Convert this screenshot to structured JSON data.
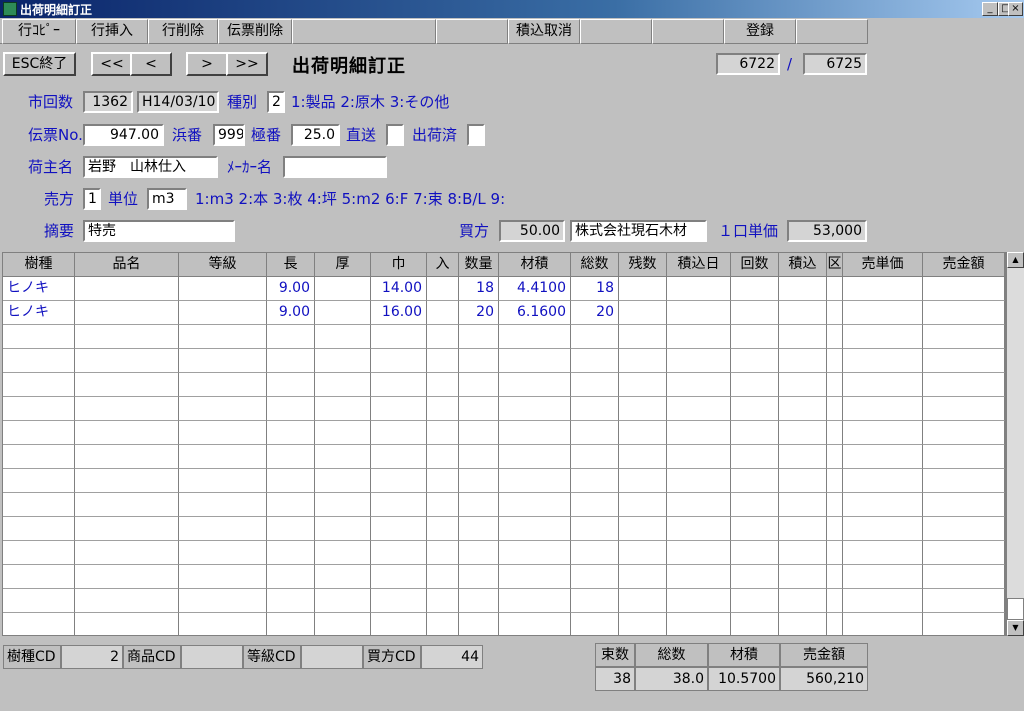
{
  "window": {
    "title": "出荷明細訂正",
    "btn_min": "_",
    "btn_max": "□",
    "btn_close": "×"
  },
  "menu": [
    "行ｺﾋﾟｰ",
    "行挿入",
    "行削除",
    "伝票削除",
    "",
    "",
    "積込取消",
    "",
    "",
    "登録",
    ""
  ],
  "toolbar": {
    "esc": "ESC終了",
    "first": "<<",
    "prev": "<",
    "next": ">",
    "last": ">>",
    "heading": "出荷明細訂正",
    "current": "6722",
    "sep": "/",
    "total": "6725"
  },
  "form": {
    "kaisu_label": "市回数",
    "kaisu": "1362",
    "date": "H14/03/10",
    "shubetsu_label": "種別",
    "shubetsu": "2",
    "shubetsu_hint": "1:製品 2:原木 3:その他",
    "denpyo_label": "伝票No.",
    "denpyo": "947.00",
    "hama_label": "浜番",
    "hama": "999",
    "goku_label": "極番",
    "goku": "25.0",
    "chokuso_label": "直送",
    "chokuso": "",
    "shukka_label": "出荷済",
    "shukka": "",
    "ninushi_label": "荷主名",
    "ninushi": "岩野　山林仕入",
    "maker_label": "ﾒｰｶｰ名",
    "maker": "",
    "urikata_label": "売方",
    "urikata": "1",
    "tani_label": "単位",
    "tani": "m3",
    "tani_hint": "1:m3 2:本 3:枚 4:坪 5:m2 6:F 7:束 8:B/L 9:",
    "tekiyo_label": "摘要",
    "tekiyo": "特売",
    "kaikata_label": "買方",
    "kaikata_num": "50.00",
    "kaikata_name": "株式会社現石木材",
    "tanka_label": "１口単価",
    "tanka": "53,000"
  },
  "grid": {
    "columns": [
      "樹種",
      "品名",
      "等級",
      "長",
      "厚",
      "巾",
      "入",
      "数量",
      "材積",
      "総数",
      "残数",
      "積込日",
      "回数",
      "積込",
      "区",
      "売単価",
      "売金額"
    ],
    "rows": [
      [
        "ヒノキ",
        "",
        "",
        "9.00",
        "",
        "14.00",
        "",
        "18",
        "4.4100",
        "18",
        "",
        "",
        "",
        "",
        "",
        "",
        ""
      ],
      [
        "ヒノキ",
        "",
        "",
        "9.00",
        "",
        "16.00",
        "",
        "20",
        "6.1600",
        "20",
        "",
        "",
        "",
        "",
        "",
        "",
        ""
      ]
    ]
  },
  "footer": {
    "jushu_cd_label": "樹種CD",
    "jushu_cd": "2",
    "shohin_cd_label": "商品CD",
    "shohin_cd": "",
    "tokyu_cd_label": "等級CD",
    "tokyu_cd": "",
    "kaikata_cd_label": "買方CD",
    "kaikata_cd": "44",
    "sum_headers": [
      "束数",
      "総数",
      "材積",
      "売金額"
    ],
    "sum_values": [
      "38",
      "38.0",
      "10.5700",
      "560,210"
    ]
  }
}
